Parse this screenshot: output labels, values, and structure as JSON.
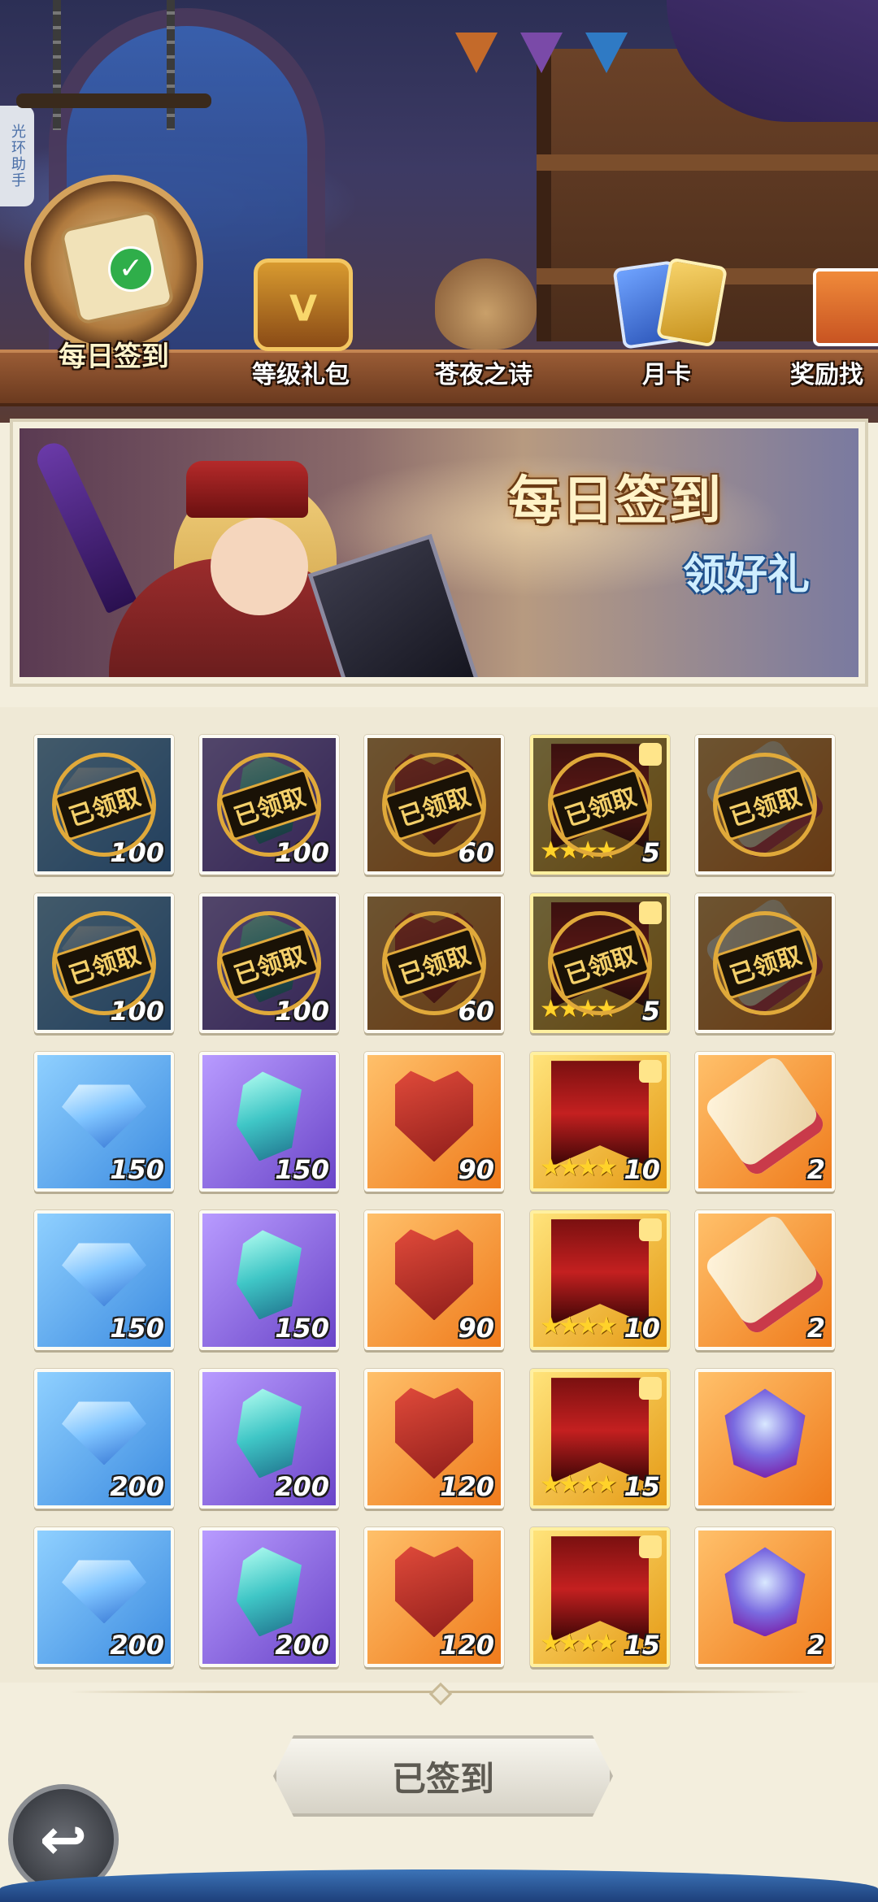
{
  "helper_tab": "光环助手",
  "tabs": [
    {
      "label": "每日签到",
      "active": true
    },
    {
      "label": "等级礼包",
      "active": false
    },
    {
      "label": "苍夜之诗",
      "active": false
    },
    {
      "label": "月卡",
      "active": false
    },
    {
      "label": "奖励找",
      "active": false
    }
  ],
  "banner": {
    "title": "每日签到",
    "subtitle": "领好礼"
  },
  "claimed_stamp": "已领取",
  "rewards": [
    [
      {
        "icon": "diamond-icon",
        "quality": "blue",
        "count": "100",
        "claimed": true
      },
      {
        "icon": "crystal-icon",
        "quality": "purple",
        "count": "100",
        "claimed": true
      },
      {
        "icon": "crown-shield-icon",
        "quality": "orange",
        "count": "60",
        "claimed": true
      },
      {
        "icon": "hero-banner-icon",
        "quality": "gold",
        "count": "5",
        "stars": 4,
        "claimed": true
      },
      {
        "icon": "scroll-icon",
        "quality": "orange",
        "count": "",
        "claimed": true
      }
    ],
    [
      {
        "icon": "diamond-icon",
        "quality": "blue",
        "count": "100",
        "claimed": true
      },
      {
        "icon": "crystal-icon",
        "quality": "purple",
        "count": "100",
        "claimed": true
      },
      {
        "icon": "crown-shield-icon",
        "quality": "orange",
        "count": "60",
        "claimed": true
      },
      {
        "icon": "hero-banner-icon",
        "quality": "gold",
        "count": "5",
        "stars": 4,
        "claimed": true
      },
      {
        "icon": "scroll-icon",
        "quality": "orange",
        "count": "",
        "claimed": true
      }
    ],
    [
      {
        "icon": "diamond-icon",
        "quality": "blue",
        "count": "150",
        "claimed": false
      },
      {
        "icon": "crystal-icon",
        "quality": "purple",
        "count": "150",
        "claimed": false
      },
      {
        "icon": "crown-shield-icon",
        "quality": "orange",
        "count": "90",
        "claimed": false
      },
      {
        "icon": "hero-banner-icon",
        "quality": "gold",
        "count": "10",
        "stars": 4,
        "claimed": false
      },
      {
        "icon": "scroll-icon",
        "quality": "orange",
        "count": "2",
        "claimed": false
      }
    ],
    [
      {
        "icon": "diamond-icon",
        "quality": "blue",
        "count": "150",
        "claimed": false
      },
      {
        "icon": "crystal-icon",
        "quality": "purple",
        "count": "150",
        "claimed": false
      },
      {
        "icon": "crown-shield-icon",
        "quality": "orange",
        "count": "90",
        "claimed": false
      },
      {
        "icon": "hero-banner-icon",
        "quality": "gold",
        "count": "10",
        "stars": 4,
        "claimed": false
      },
      {
        "icon": "scroll-icon",
        "quality": "orange",
        "count": "2",
        "claimed": false
      }
    ],
    [
      {
        "icon": "diamond-icon",
        "quality": "blue",
        "count": "200",
        "claimed": false
      },
      {
        "icon": "crystal-icon",
        "quality": "purple",
        "count": "200",
        "claimed": false
      },
      {
        "icon": "crown-shield-icon",
        "quality": "orange",
        "count": "120",
        "claimed": false
      },
      {
        "icon": "hero-banner-icon",
        "quality": "gold",
        "count": "15",
        "stars": 4,
        "claimed": false
      },
      {
        "icon": "gem-icon",
        "quality": "orange",
        "count": "",
        "claimed": false
      }
    ],
    [
      {
        "icon": "diamond-icon",
        "quality": "blue",
        "count": "200",
        "claimed": false
      },
      {
        "icon": "crystal-icon",
        "quality": "purple",
        "count": "200",
        "claimed": false
      },
      {
        "icon": "crown-shield-icon",
        "quality": "orange",
        "count": "120",
        "claimed": false
      },
      {
        "icon": "hero-banner-icon",
        "quality": "gold",
        "count": "15",
        "stars": 4,
        "claimed": false
      },
      {
        "icon": "gem-icon",
        "quality": "orange",
        "count": "2",
        "claimed": false
      }
    ]
  ],
  "sign_button": "已签到",
  "back_button_icon": "back-arrow-icon",
  "colors": {
    "accent_gold": "#e0a93a",
    "banner_title": "#fff3c8",
    "banner_subtitle": "#cfeeff",
    "panel_bg": "#efe9d6"
  }
}
